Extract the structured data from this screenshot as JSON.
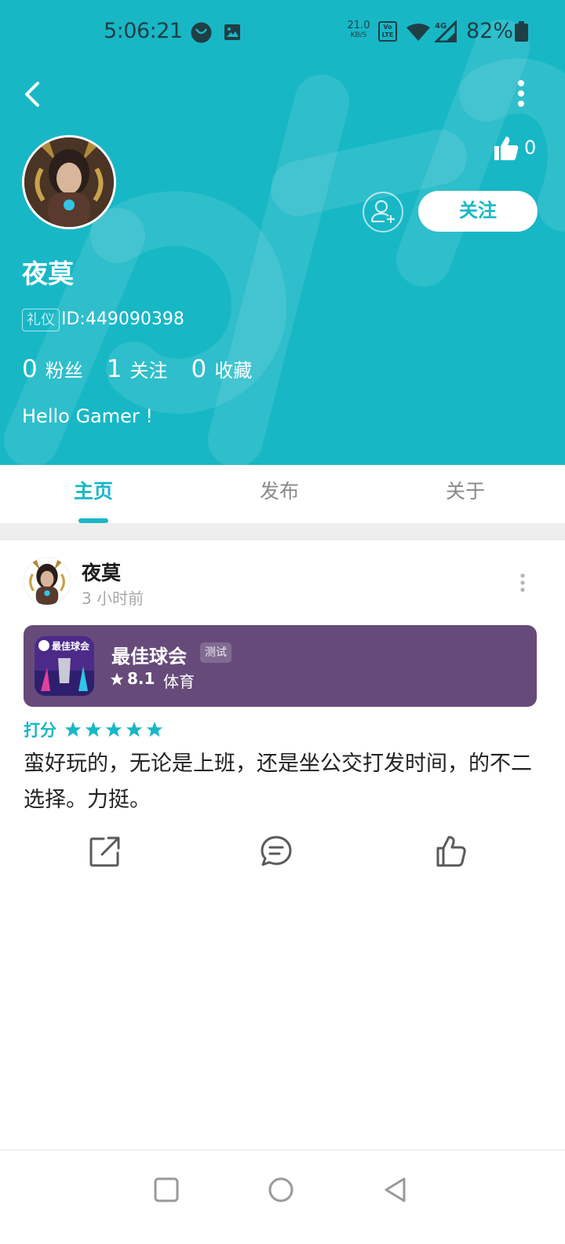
{
  "status_bar": {
    "time": "5:06:21",
    "net_speed_value": "21.0",
    "net_speed_unit": "KB/S",
    "volte_label": "Vo LTE",
    "network_type": "4G",
    "battery": "82%"
  },
  "profile": {
    "like_count": "0",
    "follow_label": "关注",
    "name": "夜莫",
    "badge": "礼仪",
    "id_text": "ID:449090398",
    "stats": [
      {
        "value": "0",
        "label": "粉丝"
      },
      {
        "value": "1",
        "label": "关注"
      },
      {
        "value": "0",
        "label": "收藏"
      }
    ],
    "bio": "Hello Gamer !"
  },
  "tabs": [
    {
      "label": "主页",
      "active": true
    },
    {
      "label": "发布",
      "active": false
    },
    {
      "label": "关于",
      "active": false
    }
  ],
  "post": {
    "author": "夜莫",
    "time": "3 小时前",
    "app": {
      "name": "最佳球会",
      "tag": "测试",
      "rating": "8.1",
      "category": "体育",
      "icon_text": "最佳球会"
    },
    "score_label": "打分",
    "score_stars": 5,
    "review": "蛮好玩的，无论是上班，还是坐公交打发时间，的不二选择。力挺。"
  },
  "colors": {
    "brand": "#18b7c6",
    "card": "#664b7a"
  },
  "icons": [
    "back-arrow-icon",
    "more-vertical-icon",
    "thumbs-up-icon",
    "add-user-icon",
    "star-icon",
    "share-icon",
    "comment-icon",
    "like-icon",
    "recents-icon",
    "home-icon",
    "back-icon"
  ]
}
